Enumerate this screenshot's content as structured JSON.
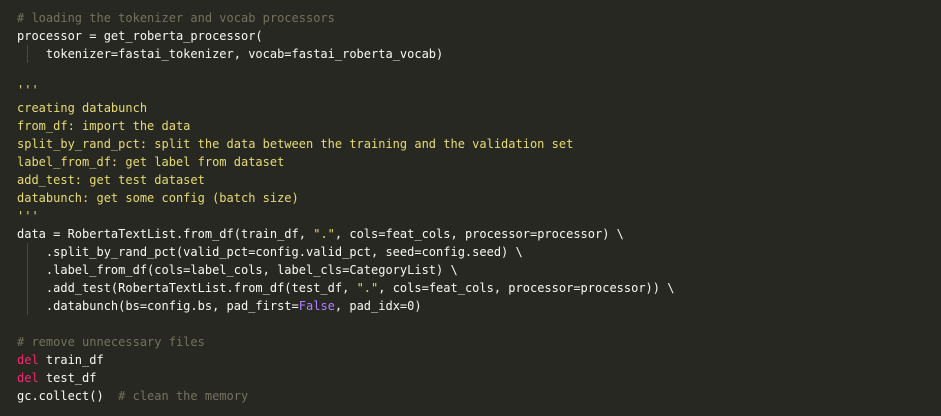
{
  "colors": {
    "background": "#272822",
    "text": "#f8f8f2",
    "comment": "#75715e",
    "string": "#e6db74",
    "keyword": "#f92672",
    "constant": "#ae81ff"
  },
  "lines": [
    {
      "indent": false,
      "tokens": [
        {
          "t": "comment",
          "v": "# loading the tokenizer and vocab processors"
        }
      ]
    },
    {
      "indent": false,
      "tokens": [
        {
          "t": "plain",
          "v": "processor = get_roberta_processor("
        }
      ]
    },
    {
      "indent": true,
      "tokens": [
        {
          "t": "plain",
          "v": "    tokenizer=fastai_tokenizer, vocab=fastai_roberta_vocab)"
        }
      ]
    },
    {
      "indent": false,
      "tokens": [
        {
          "t": "plain",
          "v": ""
        }
      ]
    },
    {
      "indent": false,
      "tokens": [
        {
          "t": "string",
          "v": "'''"
        }
      ]
    },
    {
      "indent": false,
      "tokens": [
        {
          "t": "string",
          "v": "creating databunch"
        }
      ]
    },
    {
      "indent": false,
      "tokens": [
        {
          "t": "string",
          "v": "from_df: import the data"
        }
      ]
    },
    {
      "indent": false,
      "tokens": [
        {
          "t": "string",
          "v": "split_by_rand_pct: split the data between the training and the validation set"
        }
      ]
    },
    {
      "indent": false,
      "tokens": [
        {
          "t": "string",
          "v": "label_from_df: get label from dataset"
        }
      ]
    },
    {
      "indent": false,
      "tokens": [
        {
          "t": "string",
          "v": "add_test: get test dataset"
        }
      ]
    },
    {
      "indent": false,
      "tokens": [
        {
          "t": "string",
          "v": "databunch: get some config (batch size)"
        }
      ]
    },
    {
      "indent": false,
      "tokens": [
        {
          "t": "string",
          "v": "'''"
        }
      ]
    },
    {
      "indent": false,
      "tokens": [
        {
          "t": "plain",
          "v": "data = RobertaTextList.from_df(train_df, "
        },
        {
          "t": "string",
          "v": "\".\""
        },
        {
          "t": "plain",
          "v": ", cols=feat_cols, processor=processor) \\"
        }
      ]
    },
    {
      "indent": true,
      "tokens": [
        {
          "t": "plain",
          "v": "    .split_by_rand_pct(valid_pct=config.valid_pct, seed=config.seed) \\"
        }
      ]
    },
    {
      "indent": true,
      "tokens": [
        {
          "t": "plain",
          "v": "    .label_from_df(cols=label_cols, label_cls=CategoryList) \\"
        }
      ]
    },
    {
      "indent": true,
      "tokens": [
        {
          "t": "plain",
          "v": "    .add_test(RobertaTextList.from_df(test_df, "
        },
        {
          "t": "string",
          "v": "\".\""
        },
        {
          "t": "plain",
          "v": ", cols=feat_cols, processor=processor)) \\"
        }
      ]
    },
    {
      "indent": true,
      "tokens": [
        {
          "t": "plain",
          "v": "    .databunch(bs=config.bs, pad_first="
        },
        {
          "t": "const",
          "v": "False"
        },
        {
          "t": "plain",
          "v": ", pad_idx=0)"
        }
      ]
    },
    {
      "indent": false,
      "tokens": [
        {
          "t": "plain",
          "v": ""
        }
      ]
    },
    {
      "indent": false,
      "tokens": [
        {
          "t": "comment",
          "v": "# remove unnecessary files"
        }
      ]
    },
    {
      "indent": false,
      "tokens": [
        {
          "t": "keyword",
          "v": "del"
        },
        {
          "t": "plain",
          "v": " train_df"
        }
      ]
    },
    {
      "indent": false,
      "tokens": [
        {
          "t": "keyword",
          "v": "del"
        },
        {
          "t": "plain",
          "v": " test_df"
        }
      ]
    },
    {
      "indent": false,
      "tokens": [
        {
          "t": "plain",
          "v": "gc.collect()  "
        },
        {
          "t": "comment",
          "v": "# clean the memory"
        }
      ]
    }
  ]
}
